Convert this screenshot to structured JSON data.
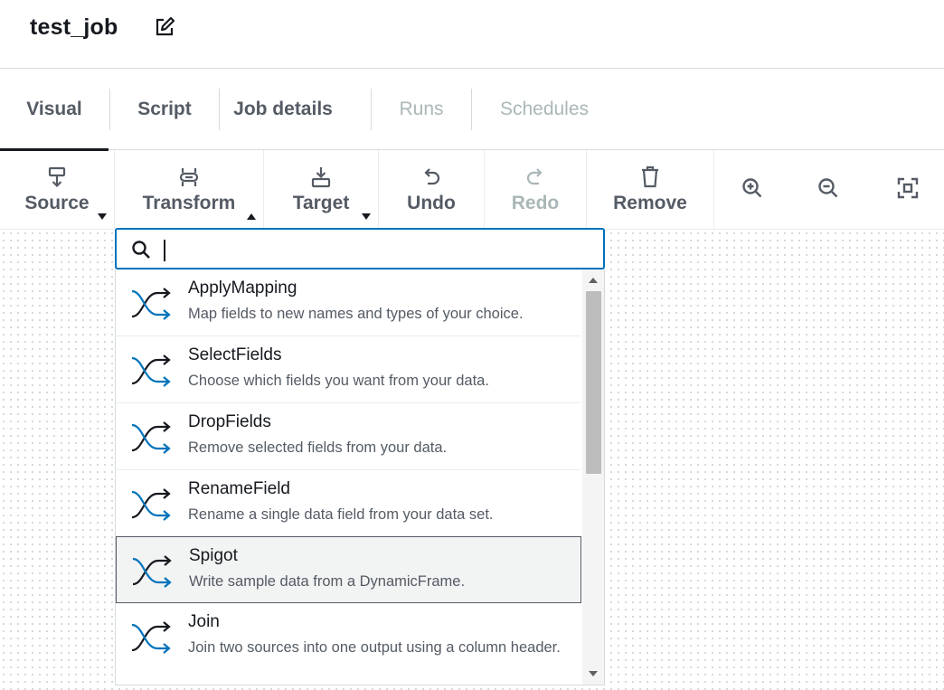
{
  "header": {
    "job_title": "test_job",
    "edit_icon": "edit-icon"
  },
  "tabs": [
    {
      "label": "Visual",
      "active": true,
      "disabled": false
    },
    {
      "label": "Script",
      "active": false,
      "disabled": false
    },
    {
      "label": "Job details",
      "active": false,
      "disabled": false
    },
    {
      "label": "Runs",
      "active": false,
      "disabled": true
    },
    {
      "label": "Schedules",
      "active": false,
      "disabled": true
    }
  ],
  "toolbar": {
    "source": {
      "label": "Source",
      "icon": "source-icon"
    },
    "transform": {
      "label": "Transform",
      "icon": "transform-icon"
    },
    "target": {
      "label": "Target",
      "icon": "target-icon"
    },
    "undo": {
      "label": "Undo",
      "icon": "undo-icon"
    },
    "redo": {
      "label": "Redo",
      "icon": "redo-icon",
      "disabled": true
    },
    "remove": {
      "label": "Remove",
      "icon": "trash-icon"
    },
    "zoom_in_icon": "zoom-in-icon",
    "zoom_out_icon": "zoom-out-icon",
    "fit_icon": "fit-screen-icon"
  },
  "search": {
    "placeholder": "",
    "value": ""
  },
  "transforms": [
    {
      "name": "ApplyMapping",
      "description": "Map fields to new names and types of your choice."
    },
    {
      "name": "SelectFields",
      "description": "Choose which fields you want from your data."
    },
    {
      "name": "DropFields",
      "description": "Remove selected fields from your data."
    },
    {
      "name": "RenameField",
      "description": "Rename a single data field from your data set."
    },
    {
      "name": "Spigot",
      "description": "Write sample data from a DynamicFrame.",
      "highlighted": true
    },
    {
      "name": "Join",
      "description": "Join two sources into one output using a column header."
    }
  ],
  "colors": {
    "accent": "#0073bb",
    "text": "#16191f",
    "muted": "#545b64",
    "disabled": "#aab7b8"
  }
}
